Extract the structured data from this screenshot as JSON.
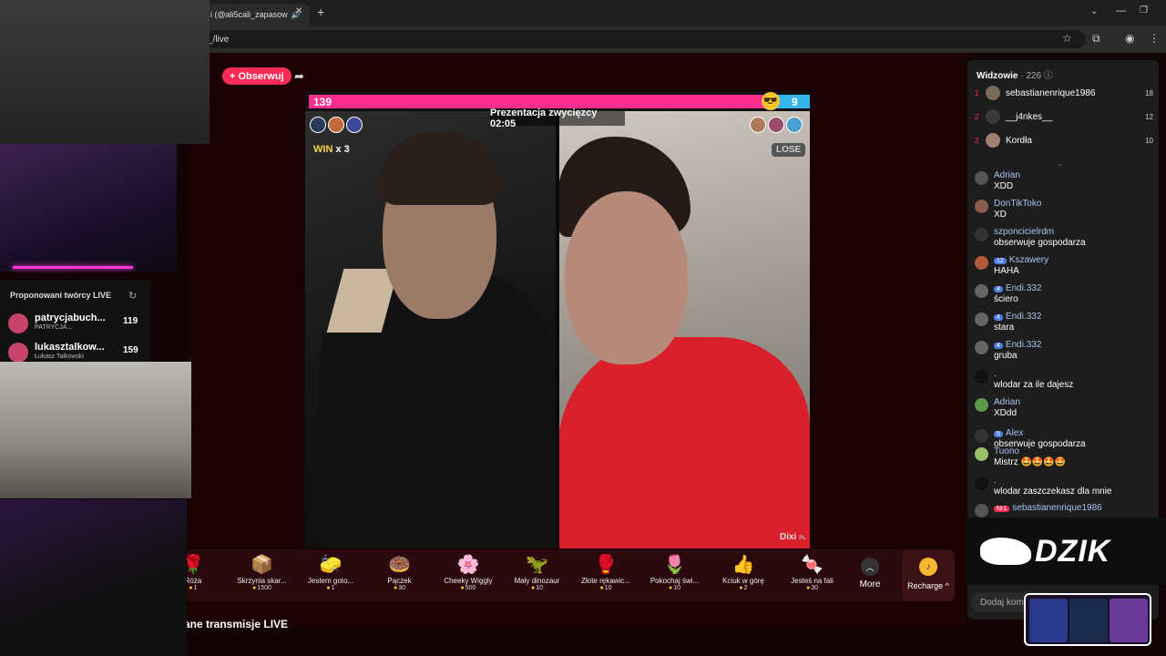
{
  "browser": {
    "tab_title": "i (@ali5cali_zapasow",
    "url": "_/live",
    "new_tab": "+",
    "tab_close": "✕"
  },
  "stream": {
    "follow_label": "+ Obserwuj",
    "score_left": "139",
    "score_right": "9",
    "phase_label": "Prezentacja zwycięzcy 02:05",
    "win_label": "WIN",
    "win_count": "x 3",
    "lose_label": "LOSE",
    "right_creator": "Dixi",
    "right_creator_suffix": "PL",
    "score_left_share": 0.92
  },
  "gifts": [
    {
      "name": "Róża",
      "price": "1",
      "icon": "🌹"
    },
    {
      "name": "Skrzynia skar...",
      "price": "1500",
      "icon": "📦"
    },
    {
      "name": "Jestem goto...",
      "price": "1",
      "icon": "🧽"
    },
    {
      "name": "Pączek",
      "price": "30",
      "icon": "🍩"
    },
    {
      "name": "Cheeky Wiggly",
      "price": "500",
      "icon": "🌸"
    },
    {
      "name": "Mały dinozaur",
      "price": "10",
      "icon": "🦖"
    },
    {
      "name": "Złote rękawic...",
      "price": "10",
      "icon": "🥊"
    },
    {
      "name": "Pokochaj świ...",
      "price": "10",
      "icon": "🌷"
    },
    {
      "name": "Kciuk w górę",
      "price": "2",
      "icon": "👍"
    },
    {
      "name": "Jesteś na fali",
      "price": "30",
      "icon": "🍬"
    }
  ],
  "gift_bar": {
    "more_label": "More",
    "recharge_label": "Recharge"
  },
  "bottom_title": "ane transmisje LIVE",
  "viewers": {
    "title": "Widzowie",
    "count": "· 226",
    "top": [
      {
        "rank": "1",
        "name": "sebastianenrique1986",
        "count": "18"
      },
      {
        "rank": "2",
        "name": "__j4nkes__",
        "count": "12"
      },
      {
        "rank": "3",
        "name": "Kordła",
        "count": "10"
      }
    ]
  },
  "chat": [
    {
      "name": "Adrian",
      "msg": "XDD",
      "badge": ""
    },
    {
      "name": "DonTikToko",
      "msg": "XD",
      "badge": ""
    },
    {
      "name": "szponcicielrdm",
      "msg": "obserwuje gospodarza",
      "badge": ""
    },
    {
      "name": "Kszawery",
      "msg": "HAHA",
      "badge": "12"
    },
    {
      "name": "Endi.332",
      "msg": "ściero",
      "badge": "4"
    },
    {
      "name": "Endi.332",
      "msg": "stara",
      "badge": "4"
    },
    {
      "name": "Endi.332",
      "msg": "gruba",
      "badge": "4"
    },
    {
      "name": ".",
      "msg": "wlodar za ile dajesz",
      "badge": ""
    },
    {
      "name": "Adrian",
      "msg": "XDdd",
      "badge": ""
    },
    {
      "name": "Alex",
      "msg": "obserwuje gospodarza",
      "badge": "5"
    },
    {
      "name": "Tuono",
      "msg": "Mistrz 🤩🤩🤩🤩",
      "badge": ""
    },
    {
      "name": ".",
      "msg": "wlodar zaszczekasz dla mnie",
      "badge": ""
    },
    {
      "name": "sebastianenrique1986",
      "msg": "",
      "badge": "Nr1"
    }
  ],
  "chat_input_placeholder": "Dodaj kom",
  "suggested": {
    "title": "Proponowani twórcy LIVE",
    "items": [
      {
        "name": "patrycjabuch...",
        "sub": "PATRYCJA...",
        "count": "119"
      },
      {
        "name": "lukasztalkow...",
        "sub": "Łukasz Talkowski",
        "count": "159"
      }
    ]
  },
  "overlay": {
    "brand": "DZIK"
  },
  "colors": {
    "accent": "#fe2c55",
    "score_pink": "#ff2d8d",
    "score_blue": "#35b6e8"
  }
}
